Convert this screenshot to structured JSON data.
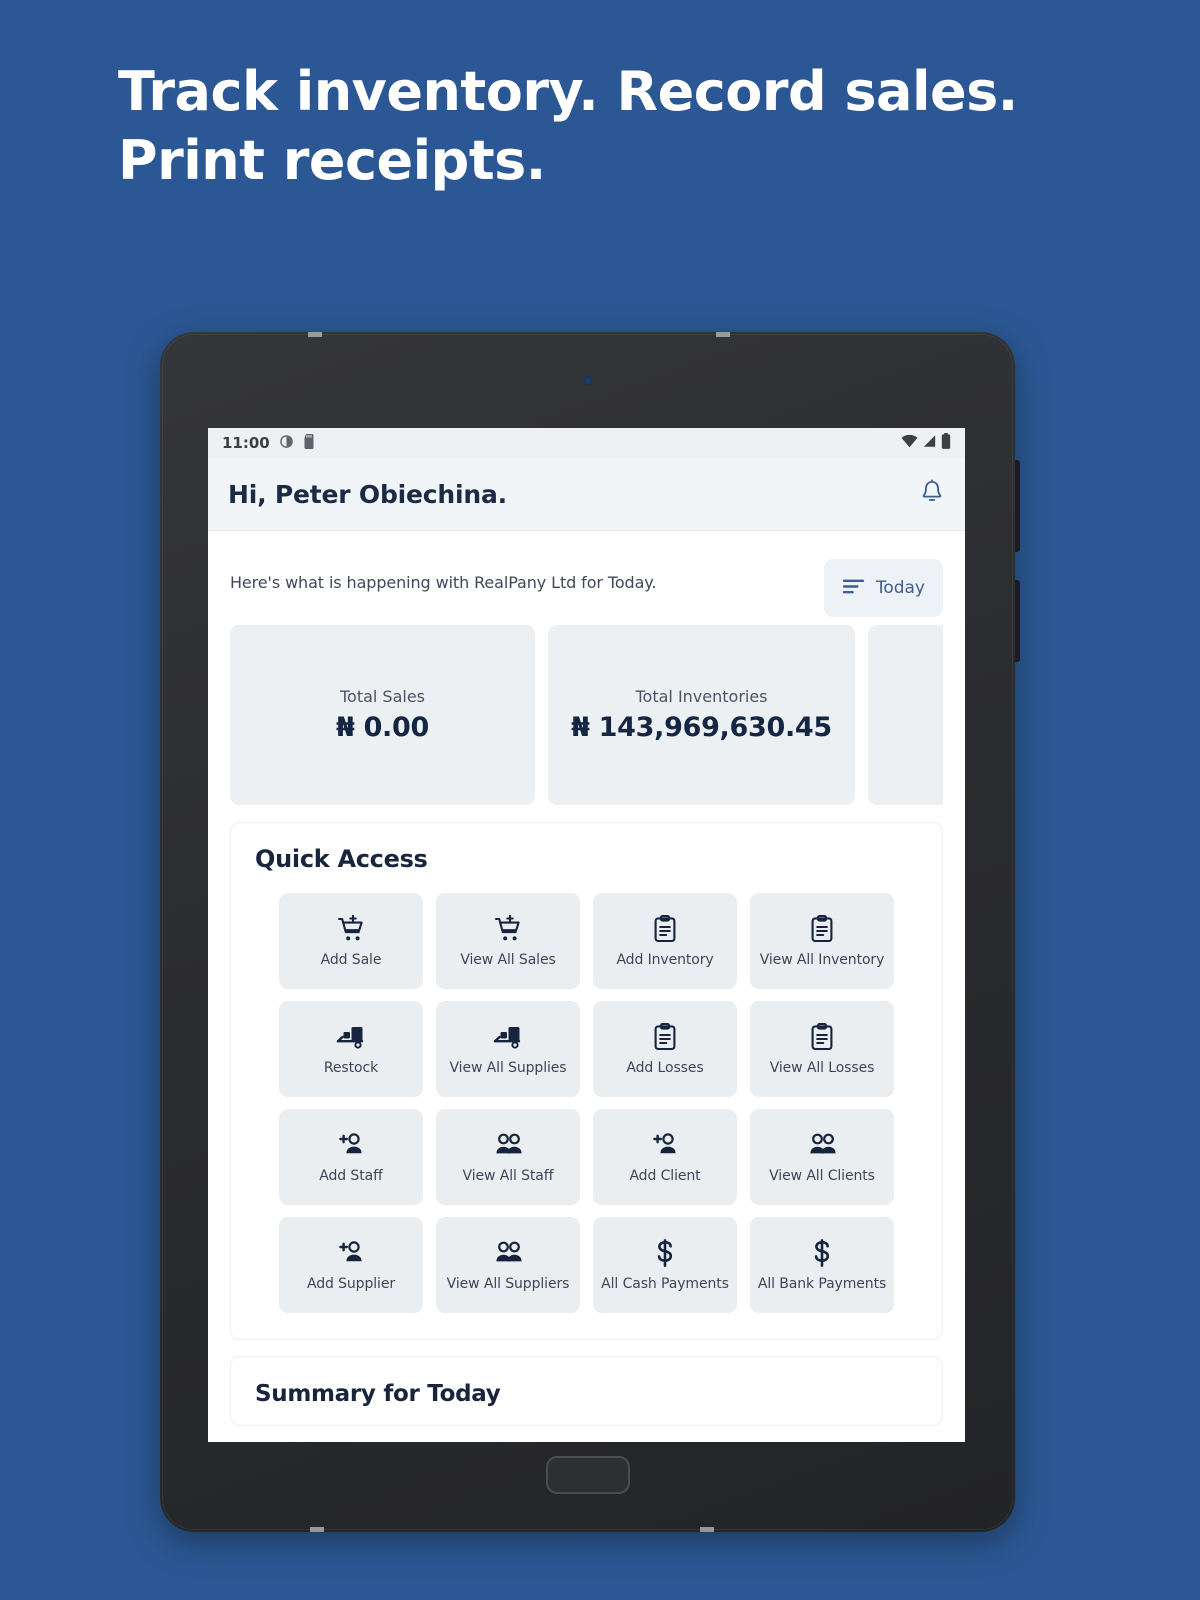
{
  "promo": {
    "headline": "Track inventory. Record sales. Print receipts."
  },
  "colors": {
    "page_background": "#2b5894",
    "accent": "#3f5d8f",
    "heading": "#18253c",
    "tile_surface": "#ebeef1",
    "card_surface": "#edf0f3"
  },
  "statusbar": {
    "time": "11:00",
    "left_icons": [
      "clock-icon",
      "sd-card-icon"
    ],
    "right_icons": [
      "wifi-icon",
      "cellular-signal-icon",
      "battery-icon"
    ]
  },
  "appbar": {
    "greeting": "Hi, Peter Obiechina.",
    "notification_icon": "bell-icon"
  },
  "dashboard": {
    "subheading": "Here's what is happening with RealPany Ltd for Today.",
    "filter": {
      "label": "Today",
      "icon": "filter-sort-icon"
    },
    "stats": [
      {
        "label": "Total Sales",
        "value": "₦ 0.00"
      },
      {
        "label": "Total Inventories",
        "value": "₦ 143,969,630.45"
      },
      {
        "label": "",
        "value": ""
      }
    ]
  },
  "quick_access": {
    "title": "Quick Access",
    "tiles": [
      {
        "label": "Add Sale",
        "icon": "cart-plus-icon"
      },
      {
        "label": "View All Sales",
        "icon": "cart-plus-icon"
      },
      {
        "label": "Add Inventory",
        "icon": "clipboard-list-icon"
      },
      {
        "label": "View All Inventory",
        "icon": "clipboard-list-icon"
      },
      {
        "label": "Restock",
        "icon": "forklift-icon"
      },
      {
        "label": "View All Supplies",
        "icon": "forklift-icon"
      },
      {
        "label": "Add Losses",
        "icon": "clipboard-list-icon"
      },
      {
        "label": "View All Losses",
        "icon": "clipboard-list-icon"
      },
      {
        "label": "Add Staff",
        "icon": "person-plus-icon"
      },
      {
        "label": "View All Staff",
        "icon": "people-icon"
      },
      {
        "label": "Add Client",
        "icon": "person-plus-icon"
      },
      {
        "label": "View All Clients",
        "icon": "people-icon"
      },
      {
        "label": "Add Supplier",
        "icon": "person-plus-icon"
      },
      {
        "label": "View All Suppliers",
        "icon": "people-icon"
      },
      {
        "label": "All Cash Payments",
        "icon": "dollar-icon"
      },
      {
        "label": "All Bank Payments",
        "icon": "dollar-icon"
      }
    ]
  },
  "bottom_section": {
    "title": "Summary for Today"
  }
}
